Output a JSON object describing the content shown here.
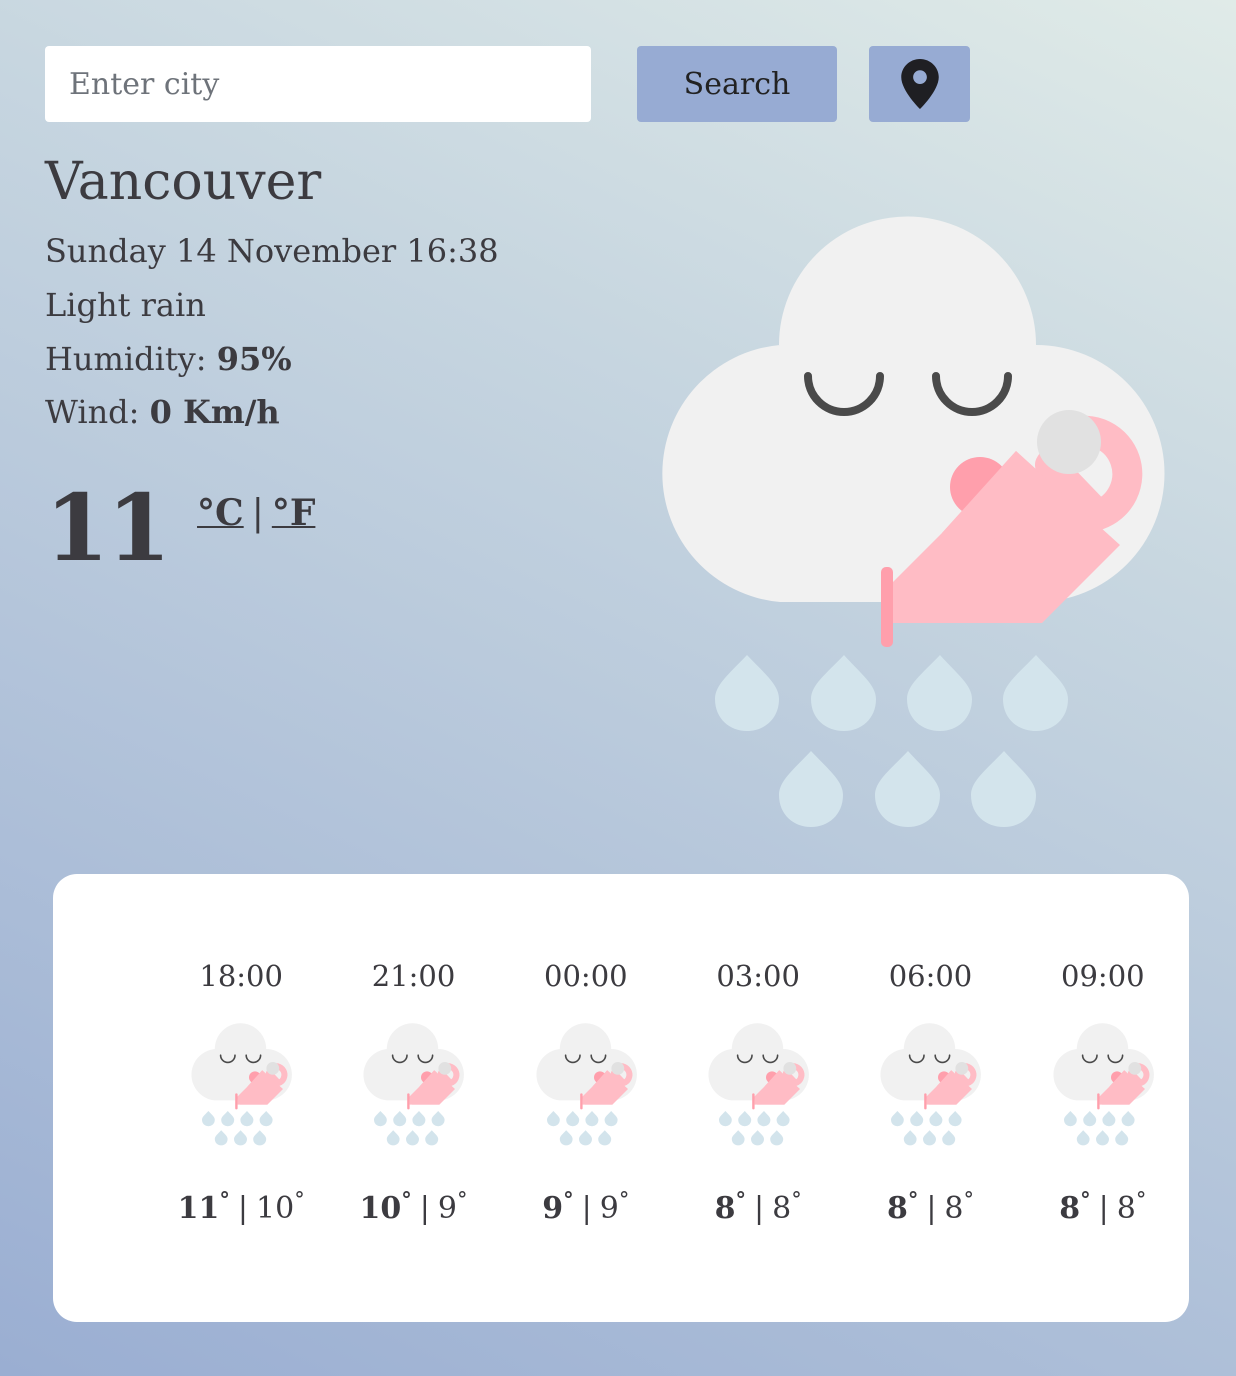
{
  "search": {
    "placeholder": "Enter city",
    "value": "",
    "button_label": "Search"
  },
  "location_button": {
    "icon": "map-pin-icon"
  },
  "current": {
    "city": "Vancouver",
    "datetime": "Sunday 14 November 16:38",
    "description": "Light rain",
    "humidity_label": "Humidity:",
    "humidity_value": "95%",
    "wind_label": "Wind:",
    "wind_value": "0 Km/h",
    "temperature": "11",
    "unit_celsius": "°C",
    "unit_separator": "|",
    "unit_fahrenheit": "°F",
    "icon": "light-rain-cloud-icon"
  },
  "forecast": [
    {
      "time": "18:00",
      "max": "11",
      "min": "10",
      "icon": "light-rain-cloud-icon"
    },
    {
      "time": "21:00",
      "max": "10",
      "min": "9",
      "icon": "light-rain-cloud-icon"
    },
    {
      "time": "00:00",
      "max": "9",
      "min": "9",
      "icon": "light-rain-cloud-icon"
    },
    {
      "time": "03:00",
      "max": "8",
      "min": "8",
      "icon": "light-rain-cloud-icon"
    },
    {
      "time": "06:00",
      "max": "8",
      "min": "8",
      "icon": "light-rain-cloud-icon"
    },
    {
      "time": "09:00",
      "max": "8",
      "min": "8",
      "icon": "light-rain-cloud-icon"
    }
  ],
  "colors": {
    "button": "#97abd3",
    "text": "#3c3b40",
    "cloud": "#f1f1f1",
    "watering_can": "#ffbcc5",
    "raindrop": "#d3e4ec"
  }
}
